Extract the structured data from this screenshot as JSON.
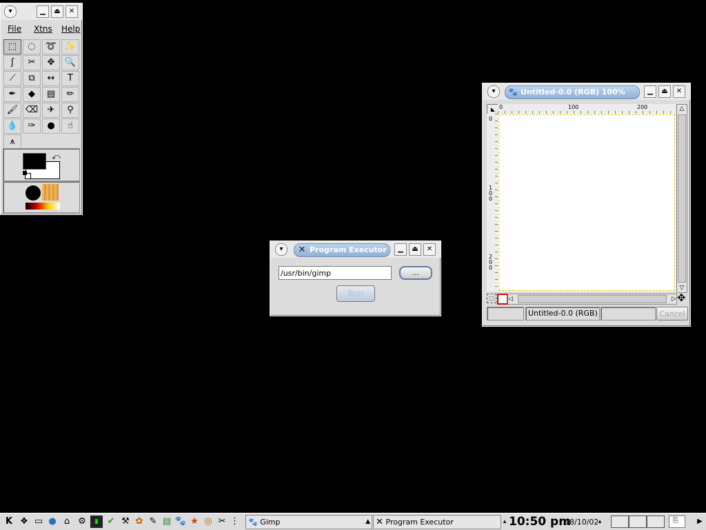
{
  "toolbox": {
    "menu": {
      "file": "File",
      "xtns": "Xtns",
      "help": "Help"
    },
    "tools": [
      {
        "icon": "rect-select-icon",
        "glyph": "⬚"
      },
      {
        "icon": "ellipse-select-icon",
        "glyph": "◌"
      },
      {
        "icon": "lasso-icon",
        "glyph": "➰"
      },
      {
        "icon": "magic-wand-icon",
        "glyph": "✨"
      },
      {
        "icon": "bezier-select-icon",
        "glyph": "ʃ"
      },
      {
        "icon": "intelligent-scissors-icon",
        "glyph": "✂"
      },
      {
        "icon": "move-icon",
        "glyph": "✥"
      },
      {
        "icon": "zoom-icon",
        "glyph": "🔍"
      },
      {
        "icon": "crop-icon",
        "glyph": "⟋"
      },
      {
        "icon": "transform-icon",
        "glyph": "⧉"
      },
      {
        "icon": "flip-icon",
        "glyph": "↔"
      },
      {
        "icon": "text-icon",
        "glyph": "T"
      },
      {
        "icon": "color-picker-icon",
        "glyph": "✒"
      },
      {
        "icon": "bucket-fill-icon",
        "glyph": "◆"
      },
      {
        "icon": "blend-icon",
        "glyph": "▤"
      },
      {
        "icon": "pencil-icon",
        "glyph": "✏"
      },
      {
        "icon": "paintbrush-icon",
        "glyph": "🖌"
      },
      {
        "icon": "eraser-icon",
        "glyph": "⌫"
      },
      {
        "icon": "airbrush-icon",
        "glyph": "✈"
      },
      {
        "icon": "clone-icon",
        "glyph": "⚲"
      },
      {
        "icon": "blur-icon",
        "glyph": "💧"
      },
      {
        "icon": "ink-icon",
        "glyph": "✑"
      },
      {
        "icon": "dodge-burn-icon",
        "glyph": "●"
      },
      {
        "icon": "smudge-icon",
        "glyph": "☝"
      },
      {
        "icon": "measure-icon",
        "glyph": "⩚"
      }
    ]
  },
  "image_window": {
    "title": "Untitled-0.0 (RGB) 100%",
    "ruler_h": [
      "0",
      "100",
      "200"
    ],
    "ruler_v": [
      "0",
      "1\n0\n0",
      "2\n0\n0"
    ],
    "status": "Untitled-0.0 (RGB)",
    "cancel": "Cancel"
  },
  "executor": {
    "title": "Program Executor",
    "path_value": "/usr/bin/gimp",
    "browse_label": "...",
    "run_label": "Run"
  },
  "taskbar": {
    "tasks": [
      {
        "label": "Gimp"
      },
      {
        "label": "Program Executor"
      }
    ],
    "clock": "10:50 pm",
    "date": "18/10/02"
  },
  "colors": {
    "desktop": "#000000",
    "title_pill": "#a9c4e2",
    "window_bg": "#dcdcdc",
    "selection_dash": "#d4c300"
  }
}
